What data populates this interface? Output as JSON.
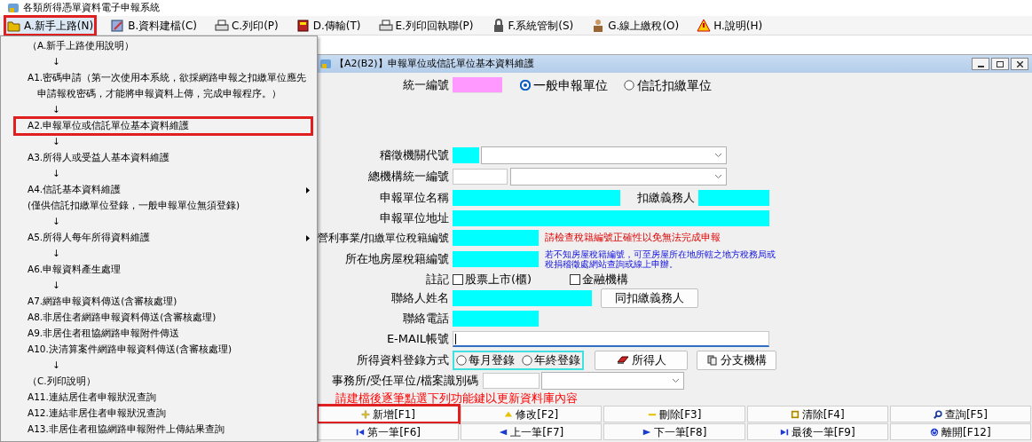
{
  "app_title": "各類所得憑單資料電子申報系統",
  "menu": [
    {
      "label": "A.新手上路(N)",
      "selected": true,
      "highlighted": true
    },
    {
      "label": "B.資料建檔(C)",
      "selected": false,
      "highlighted": false
    },
    {
      "label": "C.列印(P)",
      "selected": false,
      "highlighted": false
    },
    {
      "label": "D.傳輸(T)",
      "selected": false,
      "highlighted": false
    },
    {
      "label": "E.列印回執聯(P)",
      "selected": false,
      "highlighted": false
    },
    {
      "label": "F.系統管制(S)",
      "selected": false,
      "highlighted": false
    },
    {
      "label": "G.線上繳稅(O)",
      "selected": false,
      "highlighted": false
    },
    {
      "label": "H.說明(H)",
      "selected": false,
      "highlighted": false
    }
  ],
  "dropdown": [
    {
      "kind": "heading",
      "text": "（A.新手上路使用說明）",
      "submenu": false,
      "highlighted": false
    },
    {
      "kind": "arrow",
      "text": "↓"
    },
    {
      "kind": "item",
      "text": "A1.密碼申請（第一次使用本系統，欲採網路申報之扣繳單位應先",
      "submenu": false,
      "highlighted": false
    },
    {
      "kind": "continuation",
      "text": "申請報稅密碼，才能將申報資料上傳，完成申報程序。）",
      "submenu": false,
      "highlighted": false
    },
    {
      "kind": "arrow",
      "text": "↓"
    },
    {
      "kind": "item",
      "text": "A2.申報單位或信託單位基本資料維護",
      "submenu": false,
      "highlighted": true
    },
    {
      "kind": "arrow",
      "text": "↓"
    },
    {
      "kind": "item",
      "text": "A3.所得人或受益人基本資料維護",
      "submenu": false,
      "highlighted": false
    },
    {
      "kind": "arrow",
      "text": "↓"
    },
    {
      "kind": "item",
      "text": "A4.信託基本資料維護",
      "submenu": true,
      "highlighted": false
    },
    {
      "kind": "item",
      "text": "(僅供信託扣繳單位登錄，一般申報單位無須登錄)",
      "submenu": false,
      "highlighted": false
    },
    {
      "kind": "arrow",
      "text": "↓"
    },
    {
      "kind": "item",
      "text": "A5.所得人每年所得資料維護",
      "submenu": true,
      "highlighted": false
    },
    {
      "kind": "arrow",
      "text": "↓"
    },
    {
      "kind": "item",
      "text": "A6.申報資料產生處理",
      "submenu": false,
      "highlighted": false
    },
    {
      "kind": "arrow",
      "text": "↓"
    },
    {
      "kind": "item",
      "text": "A7.網路申報資料傳送(含審核處理)",
      "submenu": false,
      "highlighted": false
    },
    {
      "kind": "item",
      "text": "A8.非居住者網路申報資料傳送(含審核處理)",
      "submenu": false,
      "highlighted": false
    },
    {
      "kind": "item",
      "text": "A9.非居住者租協網路申報附件傳送",
      "submenu": false,
      "highlighted": false
    },
    {
      "kind": "item",
      "text": "A10.決清算案件網路申報資料傳送(含審核處理)",
      "submenu": false,
      "highlighted": false
    },
    {
      "kind": "arrow",
      "text": "↓"
    },
    {
      "kind": "heading",
      "text": "（C.列印說明）",
      "submenu": false,
      "highlighted": false
    },
    {
      "kind": "item",
      "text": "A11.連結居住者申報狀況查詢",
      "submenu": false,
      "highlighted": false
    },
    {
      "kind": "item",
      "text": "A12.連結非居住者申報狀況查詢",
      "submenu": false,
      "highlighted": false
    },
    {
      "kind": "item",
      "text": "A13.非居住者租協網路申報附件上傳結果查詢",
      "submenu": false,
      "highlighted": false
    }
  ],
  "window": {
    "title": "【A2(B2)】申報單位或信託單位基本資料維護"
  },
  "form": {
    "unified_no": {
      "label": "統一編號",
      "key": true,
      "required": false
    },
    "unit_types": [
      {
        "label": "一般申報單位",
        "selected": true
      },
      {
        "label": "信託扣繳單位",
        "selected": false
      }
    ],
    "tax_office": {
      "label": "稽徵機關代號",
      "key": false,
      "required": true
    },
    "hq_no": {
      "label": "總機構統一編號",
      "key": false,
      "required": false
    },
    "unit_name": {
      "label": "申報單位名稱",
      "key": false,
      "required": true
    },
    "withholder": {
      "label": "扣繳義務人",
      "key": false,
      "required": true
    },
    "address": {
      "label": "申報單位地址",
      "key": false,
      "required": true
    },
    "tax_reg_no": {
      "label": "營利事業/扣繳單位稅籍編號",
      "key": false,
      "required": true,
      "note": "請檢查稅籍編號正確性以免無法完成申報"
    },
    "house_tax_no": {
      "label": "所在地房屋稅籍編號",
      "key": false,
      "required": true,
      "note": "若不知房屋稅籍編號，可至房屋所在地所轄之地方稅務局或稅捐稽徵處網站查詢或線上申辦。"
    },
    "remarks": {
      "label": "註記",
      "options": [
        {
          "label": "股票上市(櫃)",
          "checked": false
        },
        {
          "label": "金融機構",
          "checked": false
        }
      ]
    },
    "contact_name": {
      "label": "聯絡人姓名",
      "key": false,
      "required": true,
      "button": "同扣繳義務人"
    },
    "contact_phone": {
      "label": "聯絡電話",
      "key": false,
      "required": true
    },
    "email": {
      "label": "E-MAIL帳號",
      "key": false,
      "required": false,
      "focused": true
    },
    "entry_method": {
      "label": "所得資料登錄方式",
      "options": [
        {
          "label": "每月登錄",
          "selected": false
        },
        {
          "label": "年終登錄",
          "selected": false
        }
      ],
      "buttons": [
        "所得人",
        "分支機構"
      ]
    },
    "office_id": {
      "label": "事務所/受任單位/檔案識別碼",
      "key": false,
      "required": false
    },
    "notice": "請建檔後逐筆點選下列功能鍵以更新資料庫內容"
  },
  "actions": [
    {
      "label": "新增[F1]",
      "highlighted": true
    },
    {
      "label": "修改[F2]",
      "highlighted": false
    },
    {
      "label": "刪除[F3]",
      "highlighted": false
    },
    {
      "label": "清除[F4]",
      "highlighted": false
    },
    {
      "label": "查詢[F5]",
      "highlighted": false
    },
    {
      "label": "第一筆[F6]",
      "highlighted": false
    },
    {
      "label": "上一筆[F7]",
      "highlighted": false
    },
    {
      "label": "下一筆[F8]",
      "highlighted": false
    },
    {
      "label": "最後一筆[F9]",
      "highlighted": false
    },
    {
      "label": "離開[F12]",
      "highlighted": false
    }
  ]
}
